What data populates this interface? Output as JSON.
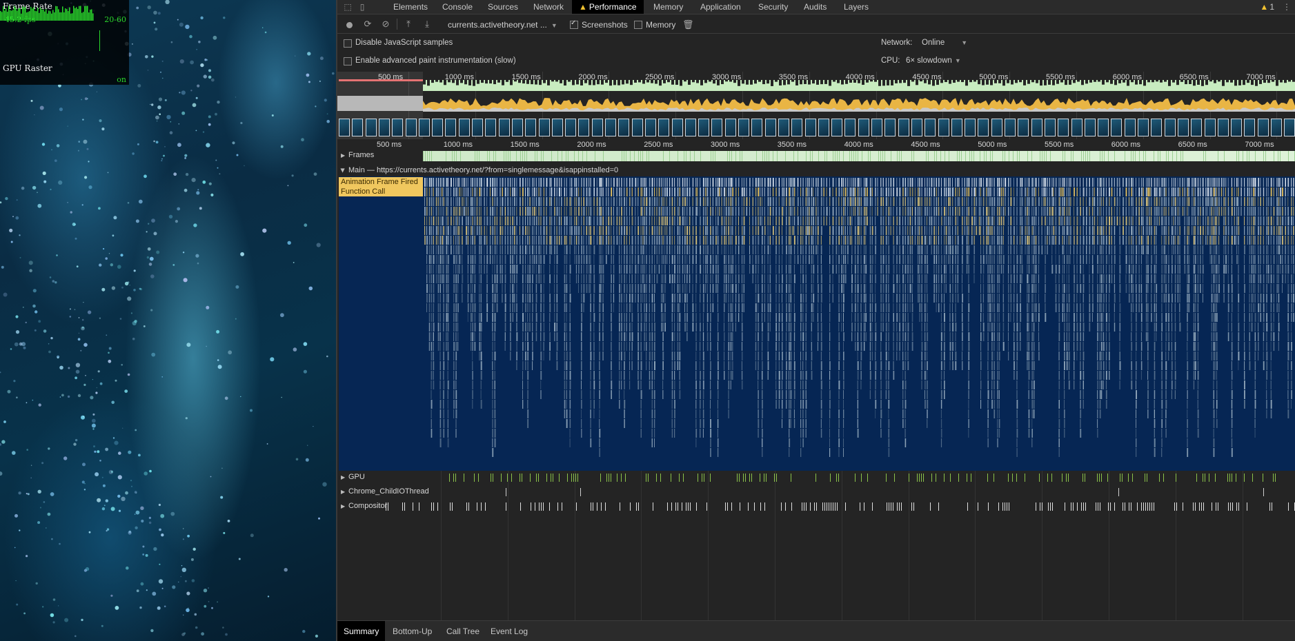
{
  "fps_meter": {
    "title": "Frame Rate",
    "fps": "45.2 fps",
    "range": "20-60",
    "gpu_label": "GPU Raster",
    "gpu_status": "on"
  },
  "devtools": {
    "tabs": [
      "Elements",
      "Console",
      "Sources",
      "Network",
      "Performance",
      "Memory",
      "Application",
      "Security",
      "Audits",
      "Layers"
    ],
    "active_tab": "Performance",
    "warning_count": "1",
    "toolbar": {
      "profile_select": "currents.activetheory.net ...",
      "screenshots_label": "Screenshots",
      "screenshots_checked": true,
      "memory_label": "Memory",
      "memory_checked": false
    },
    "settings": {
      "disable_js_samples": "Disable JavaScript samples",
      "advanced_paint": "Enable advanced paint instrumentation (slow)",
      "network_label": "Network:",
      "network_value": "Online",
      "cpu_label": "CPU:",
      "cpu_value": "6× slowdown"
    },
    "overview_ticks": [
      "500 ms",
      "1000 ms",
      "1500 ms",
      "2000 ms",
      "2500 ms",
      "3000 ms",
      "3500 ms",
      "4000 ms",
      "4500 ms",
      "5000 ms",
      "5500 ms",
      "6000 ms",
      "6500 ms",
      "7000 ms"
    ],
    "ruler_ticks": [
      "500 ms",
      "1000 ms",
      "1500 ms",
      "2000 ms",
      "2500 ms",
      "3000 ms",
      "3500 ms",
      "4000 ms",
      "4500 ms",
      "5000 ms",
      "5500 ms",
      "6000 ms",
      "6500 ms",
      "7000 ms"
    ],
    "tracks": {
      "frames": "Frames",
      "main": "Main — https://currents.activetheory.net/?from=singlemessage&isappinstalled=0",
      "animation_event": "Animation Frame Fired",
      "function_event": "Function Call",
      "gpu": "GPU",
      "io_thread": "Chrome_ChildIOThread",
      "compositor": "Compositor"
    },
    "bottom_tabs": [
      "Summary",
      "Bottom-Up",
      "Call Tree",
      "Event Log"
    ],
    "active_bottom_tab": "Summary"
  },
  "colors": {
    "fps_green": "#2bd92b",
    "scripting_yellow": "#f0c75e",
    "frames_green": "#cfe9c9",
    "flame_bg": "#062654",
    "gpu_mark": "#8bc34a"
  },
  "icons": [
    "inspect-icon",
    "device-toggle-icon",
    "record-icon",
    "reload-icon",
    "clear-icon",
    "upload-icon",
    "download-icon",
    "trash-icon",
    "warning-icon",
    "kebab-icon"
  ]
}
